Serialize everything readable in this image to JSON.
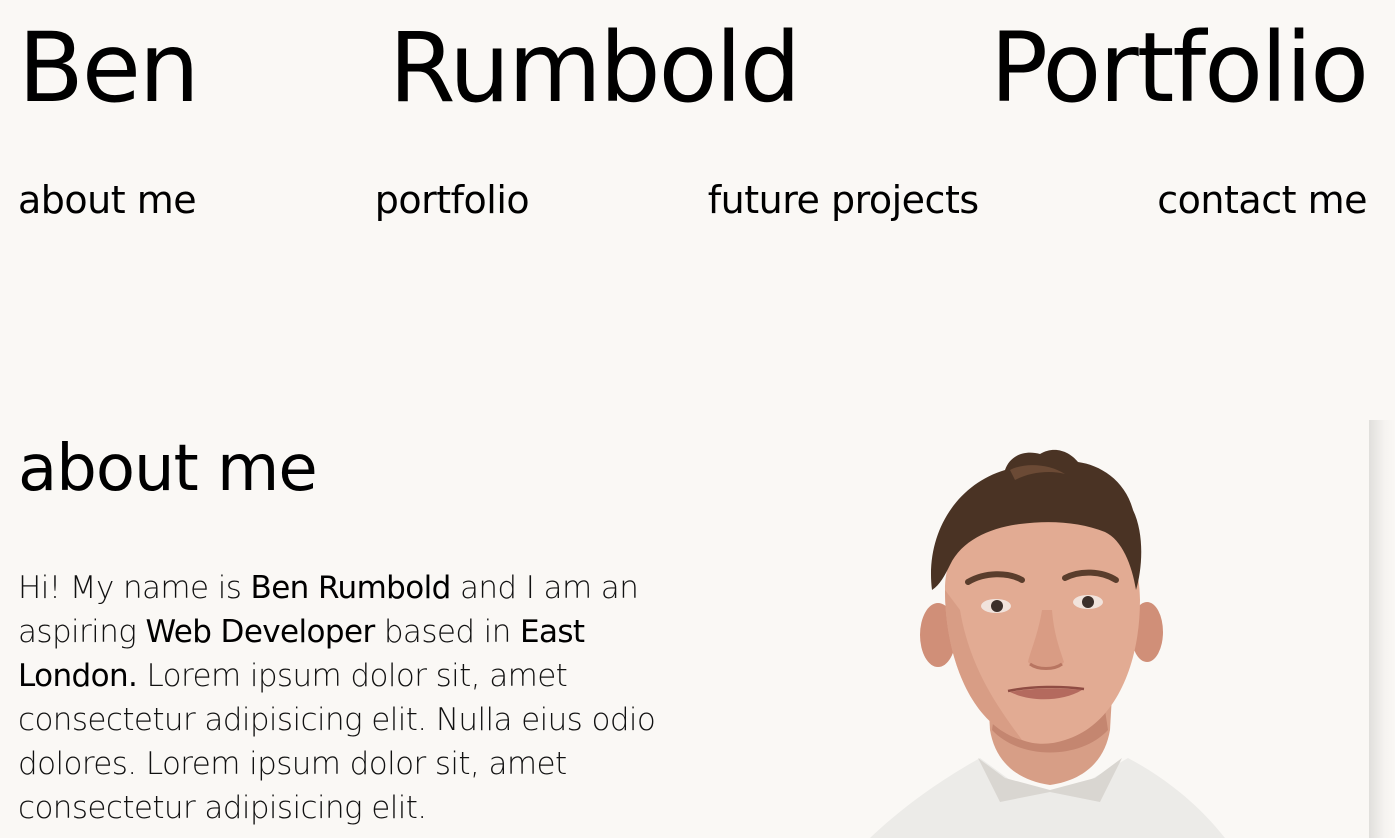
{
  "header": {
    "title_words": [
      "Ben",
      "Rumbold",
      "Portfolio"
    ]
  },
  "nav": {
    "items": [
      "about me",
      "portfolio",
      "future projects",
      "contact me"
    ]
  },
  "about": {
    "heading": "about me",
    "text": {
      "p1": "Hi! My name is ",
      "name": "Ben Rumbold",
      "p2": " and I am an aspiring ",
      "role": "Web Developer",
      "p3": " based in ",
      "location": "East London.",
      "p4": " Lorem ipsum dolor sit, amet consectetur adipisicing elit. Nulla eius odio dolores. Lorem ipsum dolor sit, amet consectetur adipisicing elit."
    }
  },
  "colors": {
    "background": "#faf8f5",
    "text": "#000000"
  }
}
